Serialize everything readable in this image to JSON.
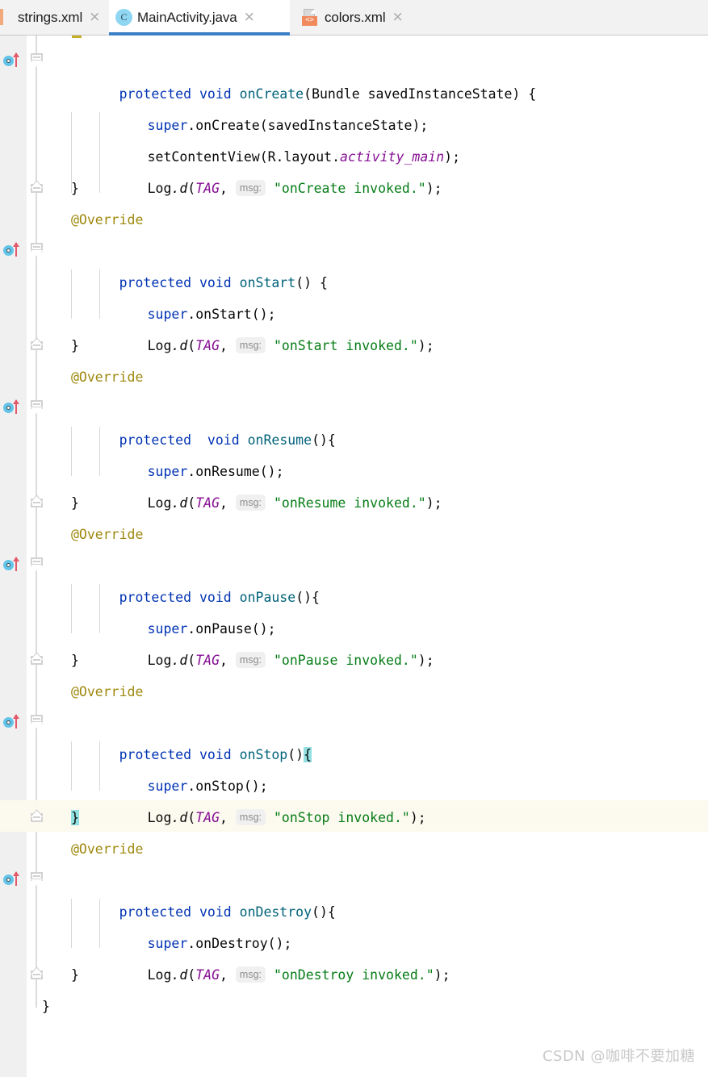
{
  "window": {
    "app": "Android Studio Editor",
    "accent_color": "#3b7fc4",
    "gutter_color": "#f0f0f0",
    "current_line_color": "#fcf9ef",
    "brace_match_color": "#93e0e3"
  },
  "tabbar": {
    "tabs": [
      {
        "label": "strings.xml",
        "icon": "xml-resource-icon",
        "active": false,
        "close_glyph": "×"
      },
      {
        "label": "MainActivity.java",
        "icon": "java-class-icon",
        "active": true,
        "close_glyph": "×"
      },
      {
        "label": "colors.xml",
        "icon": "xml-resource-icon",
        "active": false,
        "close_glyph": "×"
      }
    ],
    "xml_badge_text": "<>"
  },
  "editor": {
    "language": "java",
    "param_hint_label": "msg:",
    "lines": [
      {
        "id": "l1",
        "text": "protected void onCreate(Bundle savedInstanceState) {"
      },
      {
        "id": "l2",
        "text": "super.onCreate(savedInstanceState);"
      },
      {
        "id": "l3",
        "text": "setContentView(R.layout.activity_main);"
      },
      {
        "id": "l4",
        "text": "Log.d(TAG, msg: \"onCreate invoked.\");"
      },
      {
        "id": "l5",
        "text": "}"
      },
      {
        "id": "l6",
        "text": "@Override"
      },
      {
        "id": "l7",
        "text": "protected void onStart() {"
      },
      {
        "id": "l8",
        "text": "super.onStart();"
      },
      {
        "id": "l9",
        "text": "Log.d(TAG, msg: \"onStart invoked.\");"
      },
      {
        "id": "l10",
        "text": "}"
      },
      {
        "id": "l11",
        "text": "@Override"
      },
      {
        "id": "l12",
        "text": "protected  void onResume(){"
      },
      {
        "id": "l13",
        "text": "super.onResume();"
      },
      {
        "id": "l14",
        "text": "Log.d(TAG, msg: \"onResume invoked.\");"
      },
      {
        "id": "l15",
        "text": "}"
      },
      {
        "id": "l16",
        "text": "@Override"
      },
      {
        "id": "l17",
        "text": "protected void onPause(){"
      },
      {
        "id": "l18",
        "text": "super.onPause();"
      },
      {
        "id": "l19",
        "text": "Log.d(TAG, msg: \"onPause invoked.\");"
      },
      {
        "id": "l20",
        "text": "}"
      },
      {
        "id": "l21",
        "text": "@Override"
      },
      {
        "id": "l22",
        "text": "protected void onStop(){"
      },
      {
        "id": "l23",
        "text": "super.onStop();"
      },
      {
        "id": "l24",
        "text": "Log.d(TAG, msg: \"onStop invoked.\");"
      },
      {
        "id": "l25",
        "text": "}"
      },
      {
        "id": "l26",
        "text": "@Override"
      },
      {
        "id": "l27",
        "text": "protected void onDestroy(){"
      },
      {
        "id": "l28",
        "text": "super.onDestroy();"
      },
      {
        "id": "l29",
        "text": "Log.d(TAG, msg: \"onDestroy invoked.\");"
      },
      {
        "id": "l30",
        "text": "}"
      },
      {
        "id": "l31",
        "text": "}"
      }
    ],
    "tokens": {
      "protected": "protected",
      "void": "void",
      "space": " ",
      "super": "super",
      "dot": ".",
      "semi": ";",
      "open_brace": "{",
      "close_brace": "}",
      "open_paren": "(",
      "close_paren": ")",
      "comma": ",",
      "override": "@Override",
      "log": "Log",
      "log_d": ".d",
      "tag": "TAG",
      "bundle": "Bundle",
      "saved_instance_state": "savedInstanceState",
      "set_content_view": "setContentView",
      "r_layout": "R.layout.",
      "activity_main": "activity_main",
      "on_create": "onCreate",
      "on_start": "onStart",
      "on_resume": "onResume",
      "on_pause": "onPause",
      "on_stop": "onStop",
      "on_destroy": "onDestroy",
      "str_on_create": "\"onCreate invoked.\"",
      "str_on_start": "\"onStart invoked.\"",
      "str_on_resume": "\"onResume invoked.\"",
      "str_on_pause": "\"onPause invoked.\"",
      "str_on_stop": "\"onStop invoked.\"",
      "str_on_destroy": "\"onDestroy invoked.\""
    }
  },
  "watermark": {
    "text": "CSDN @咖啡不要加糖"
  }
}
